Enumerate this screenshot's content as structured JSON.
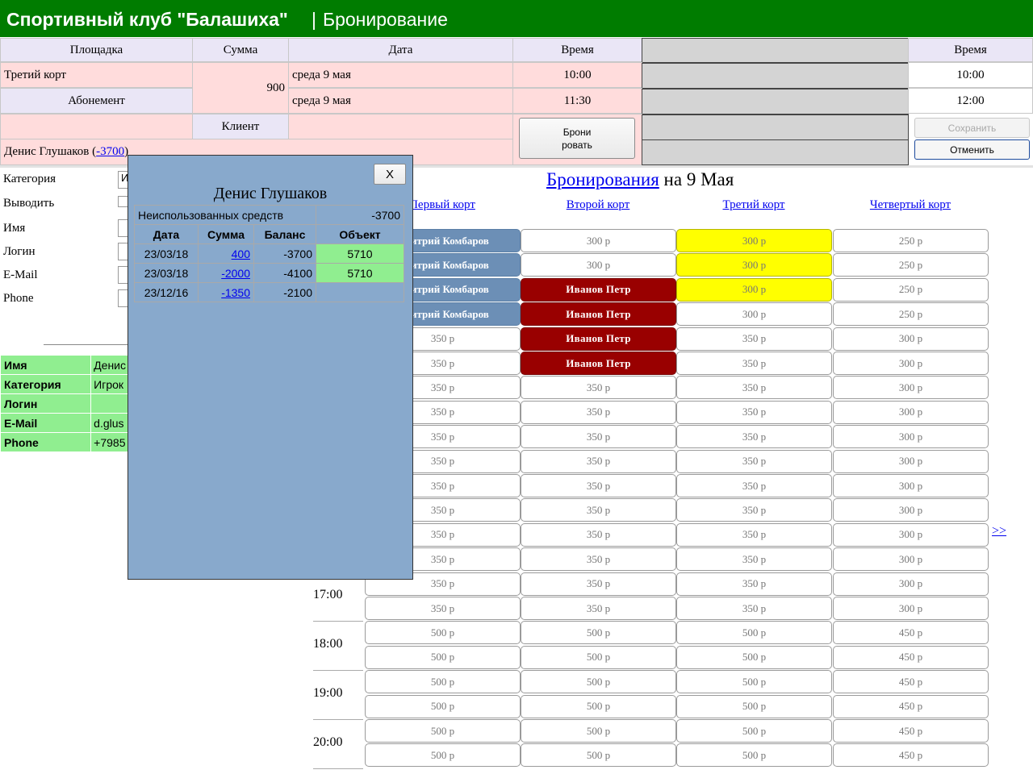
{
  "header": {
    "title": "Спортивный клуб \"Балашиха\"",
    "separator": "|",
    "section": "Бронирование"
  },
  "booking": {
    "col_place": "Площадка",
    "col_sum": "Сумма",
    "col_date": "Дата",
    "col_time": "Время",
    "col_time2": "Время",
    "place": "Третий корт",
    "type": "Абонемент",
    "sum": "900",
    "date1": "среда 9 мая",
    "date2": "среда 9 мая",
    "time1": "10:00",
    "time2": "11:30",
    "time_right1": "10:00",
    "time_right2": "12:00",
    "client_label": "Клиент",
    "client_name": "Денис Глушаков (",
    "client_balance": "-3700",
    "client_close_paren": ")",
    "book_button_line1": "Брони",
    "book_button_line2": "ровать",
    "save_button": "Сохранить",
    "cancel_button": "Отменить"
  },
  "form": {
    "category": "Категория",
    "category_value": "И",
    "show": "Выводить",
    "name": "Имя",
    "login": "Логин",
    "email": "E-Mail",
    "phone": "Phone"
  },
  "client_info": {
    "rows": [
      {
        "label": "Имя",
        "value": "Денис"
      },
      {
        "label": "Категория",
        "value": "Игрок"
      },
      {
        "label": "Логин",
        "value": ""
      },
      {
        "label": "E-Mail",
        "value": "d.glus"
      },
      {
        "label": "Phone",
        "value": "+7985"
      }
    ]
  },
  "schedule": {
    "title_link": "Бронирования",
    "title_rest": " на 9 Мая",
    "courts": [
      "Первый корт",
      "Второй корт",
      "Третий корт",
      "Четвертый корт"
    ],
    "next_link": ">>",
    "times": [
      "17:00",
      "18:00",
      "19:00",
      "20:00"
    ],
    "rows": [
      [
        "Дмитрий Комбаров",
        "300 р",
        "300 р",
        "250 р"
      ],
      [
        "Дмитрий Комбаров",
        "300 р",
        "300 р",
        "250 р"
      ],
      [
        "Дмитрий Комбаров",
        "Иванов Петр",
        "300 р",
        "250 р"
      ],
      [
        "Дмитрий Комбаров",
        "Иванов Петр",
        "300 р",
        "250 р"
      ],
      [
        "350 р",
        "Иванов Петр",
        "350 р",
        "300 р"
      ],
      [
        "350 р",
        "Иванов Петр",
        "350 р",
        "300 р"
      ],
      [
        "350 р",
        "350 р",
        "350 р",
        "300 р"
      ],
      [
        "350 р",
        "350 р",
        "350 р",
        "300 р"
      ],
      [
        "350 р",
        "350 р",
        "350 р",
        "300 р"
      ],
      [
        "350 р",
        "350 р",
        "350 р",
        "300 р"
      ],
      [
        "350 р",
        "350 р",
        "350 р",
        "300 р"
      ],
      [
        "350 р",
        "350 р",
        "350 р",
        "300 р"
      ],
      [
        "350 р",
        "350 р",
        "350 р",
        "300 р"
      ],
      [
        "350 р",
        "350 р",
        "350 р",
        "300 р"
      ],
      [
        "350 р",
        "350 р",
        "350 р",
        "300 р"
      ],
      [
        "350 р",
        "350 р",
        "350 р",
        "300 р"
      ],
      [
        "500 р",
        "500 р",
        "500 р",
        "450 р"
      ],
      [
        "500 р",
        "500 р",
        "500 р",
        "450 р"
      ],
      [
        "500 р",
        "500 р",
        "500 р",
        "450 р"
      ],
      [
        "500 р",
        "500 р",
        "500 р",
        "450 р"
      ],
      [
        "500 р",
        "500 р",
        "500 р",
        "450 р"
      ],
      [
        "500 р",
        "500 р",
        "500 р",
        "450 р"
      ]
    ],
    "states": [
      [
        "blue",
        "",
        "yellow",
        ""
      ],
      [
        "blue",
        "",
        "yellow",
        ""
      ],
      [
        "blue",
        "red",
        "yellow",
        ""
      ],
      [
        "blue",
        "red",
        "",
        ""
      ],
      [
        "",
        "red",
        "",
        ""
      ],
      [
        "",
        "red",
        "",
        ""
      ]
    ]
  },
  "popup": {
    "title": "Денис Глушаков",
    "close": "X",
    "unused_label": "Неиспользованных средств",
    "unused_value": "-3700",
    "columns": [
      "Дата",
      "Сумма",
      "Баланс",
      "Объект"
    ],
    "rows": [
      {
        "date": "23/03/18",
        "sum": "400",
        "balance": "-3700",
        "object": "5710"
      },
      {
        "date": "23/03/18",
        "sum": "-2000",
        "balance": "-4100",
        "object": "5710"
      },
      {
        "date": "23/12/16",
        "sum": "-1350",
        "balance": "-2100",
        "object": ""
      }
    ]
  },
  "colors": {
    "header": "#007c00",
    "pink": "#ffdcdc",
    "busy_blue": "#6c8fb6",
    "busy_red": "#990000",
    "highlight": "#ffff00",
    "popup": "#88a9cc",
    "green_cell": "#90ee90"
  }
}
